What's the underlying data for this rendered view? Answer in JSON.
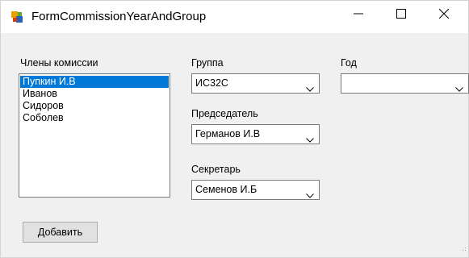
{
  "window": {
    "title": "FormCommissionYearAndGroup",
    "icon": "winforms-app-icon",
    "controls": [
      "minimize-icon",
      "maximize-icon",
      "close-icon"
    ]
  },
  "members": {
    "label": "Члены комиссии",
    "items": [
      "Пупкин И.В",
      "Иванов",
      "Сидоров",
      "Соболев"
    ],
    "selected_index": 0
  },
  "group": {
    "label": "Группа",
    "value": "ИС32С"
  },
  "year": {
    "label": "Год",
    "value": ""
  },
  "chairman": {
    "label": "Председатель",
    "value": "Германов И.В"
  },
  "secretary": {
    "label": "Секретарь",
    "value": "Семенов И.Б"
  },
  "add_button": {
    "label": "Добавить"
  },
  "colors": {
    "selection": "#0078d7",
    "window_bg": "#f0f0f0",
    "titlebar_bg": "#ffffff"
  }
}
